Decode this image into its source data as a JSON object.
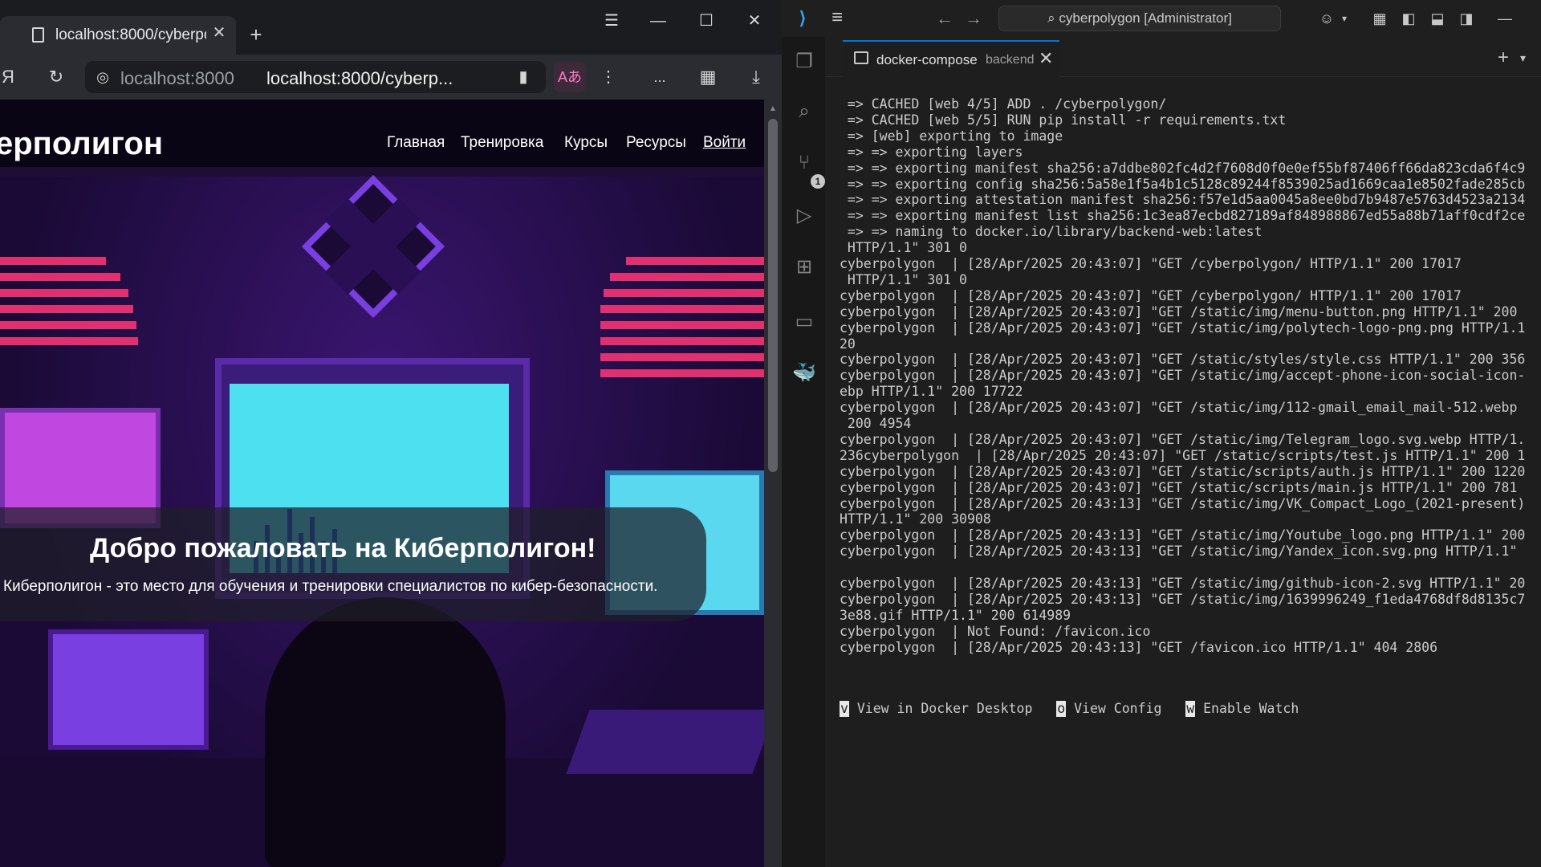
{
  "browser": {
    "tab_title": "localhost:8000/cyberpo",
    "url_ghost": "localhost:8000",
    "url_main": "localhost:8000/cyberp...",
    "toolbar_more": "..."
  },
  "site": {
    "title": "ерполигон",
    "nav": [
      "Главная",
      "Тренировка",
      "Курсы",
      "Ресурсы",
      "Войти"
    ],
    "welcome_title": "Добро пожаловать на Киберполигон!",
    "welcome_sub": "Киберполигон - это место для обучения и тренировки специалистов по кибер-безопасности."
  },
  "vscode": {
    "search_text": "cyberpolygon [Administrator]",
    "activity_badge": "1",
    "tab_name": "docker-compose",
    "tab_desc": "backend",
    "terminal_lines": [
      " => CACHED [web 4/5] ADD . /cyberpolygon/",
      " => CACHED [web 5/5] RUN pip install -r requirements.txt",
      " => [web] exporting to image",
      " => => exporting layers",
      " => => exporting manifest sha256:a7ddbe802fc4d2f7608d0f0e0ef55bf87406ff66da823cda6f4c9",
      " => => exporting config sha256:5a58e1f5a4b1c5128c89244f8539025ad1669caa1e8502fade285cb",
      " => => exporting attestation manifest sha256:f57e1d5aa0045a8ee0bd7b9487e5763d4523a2134",
      " => => exporting manifest list sha256:1c3ea87ecbd827189af848988867ed55a88b71aff0cdf2ce",
      " => => naming to docker.io/library/backend-web:latest",
      " HTTP/1.1\" 301 0",
      "cyberpolygon  | [28/Apr/2025 20:43:07] \"GET /cyberpolygon/ HTTP/1.1\" 200 17017",
      " HTTP/1.1\" 301 0",
      "cyberpolygon  | [28/Apr/2025 20:43:07] \"GET /cyberpolygon/ HTTP/1.1\" 200 17017",
      "cyberpolygon  | [28/Apr/2025 20:43:07] \"GET /static/img/menu-button.png HTTP/1.1\" 200",
      "cyberpolygon  | [28/Apr/2025 20:43:07] \"GET /static/img/polytech-logo-png.png HTTP/1.1",
      "20",
      "cyberpolygon  | [28/Apr/2025 20:43:07] \"GET /static/styles/style.css HTTP/1.1\" 200 356",
      "cyberpolygon  | [28/Apr/2025 20:43:07] \"GET /static/img/accept-phone-icon-social-icon-",
      "ebp HTTP/1.1\" 200 17722",
      "cyberpolygon  | [28/Apr/2025 20:43:07] \"GET /static/img/112-gmail_email_mail-512.webp",
      " 200 4954",
      "cyberpolygon  | [28/Apr/2025 20:43:07] \"GET /static/img/Telegram_logo.svg.webp HTTP/1.",
      "236cyberpolygon  | [28/Apr/2025 20:43:07] \"GET /static/scripts/test.js HTTP/1.1\" 200 1",
      "cyberpolygon  | [28/Apr/2025 20:43:07] \"GET /static/scripts/auth.js HTTP/1.1\" 200 1220",
      "cyberpolygon  | [28/Apr/2025 20:43:07] \"GET /static/scripts/main.js HTTP/1.1\" 200 781",
      "cyberpolygon  | [28/Apr/2025 20:43:13] \"GET /static/img/VK_Compact_Logo_(2021-present)",
      "HTTP/1.1\" 200 30908",
      "cyberpolygon  | [28/Apr/2025 20:43:13] \"GET /static/img/Youtube_logo.png HTTP/1.1\" 200",
      "cyberpolygon  | [28/Apr/2025 20:43:13] \"GET /static/img/Yandex_icon.svg.png HTTP/1.1\"",
      "",
      "cyberpolygon  | [28/Apr/2025 20:43:13] \"GET /static/img/github-icon-2.svg HTTP/1.1\" 20",
      "cyberpolygon  | [28/Apr/2025 20:43:13] \"GET /static/img/1639996249_f1eda4768df8d8135c7",
      "3e88.gif HTTP/1.1\" 200 614989",
      "cyberpolygon  | Not Found: /favicon.ico",
      "cyberpolygon  | [28/Apr/2025 20:43:13] \"GET /favicon.ico HTTP/1.1\" 404 2806"
    ],
    "shortcuts": [
      {
        "key": "v",
        "label": " View in Docker Desktop"
      },
      {
        "key": "o",
        "label": " View Config"
      },
      {
        "key": "w",
        "label": " Enable Watch"
      }
    ]
  },
  "icons": {
    "doc": "document-icon",
    "close": "close-icon",
    "plus": "plus-icon"
  },
  "colors": {
    "accent_pink": "#e0306e",
    "accent_cyan": "#4de0f0",
    "vscode_blue": "#0078d4"
  }
}
